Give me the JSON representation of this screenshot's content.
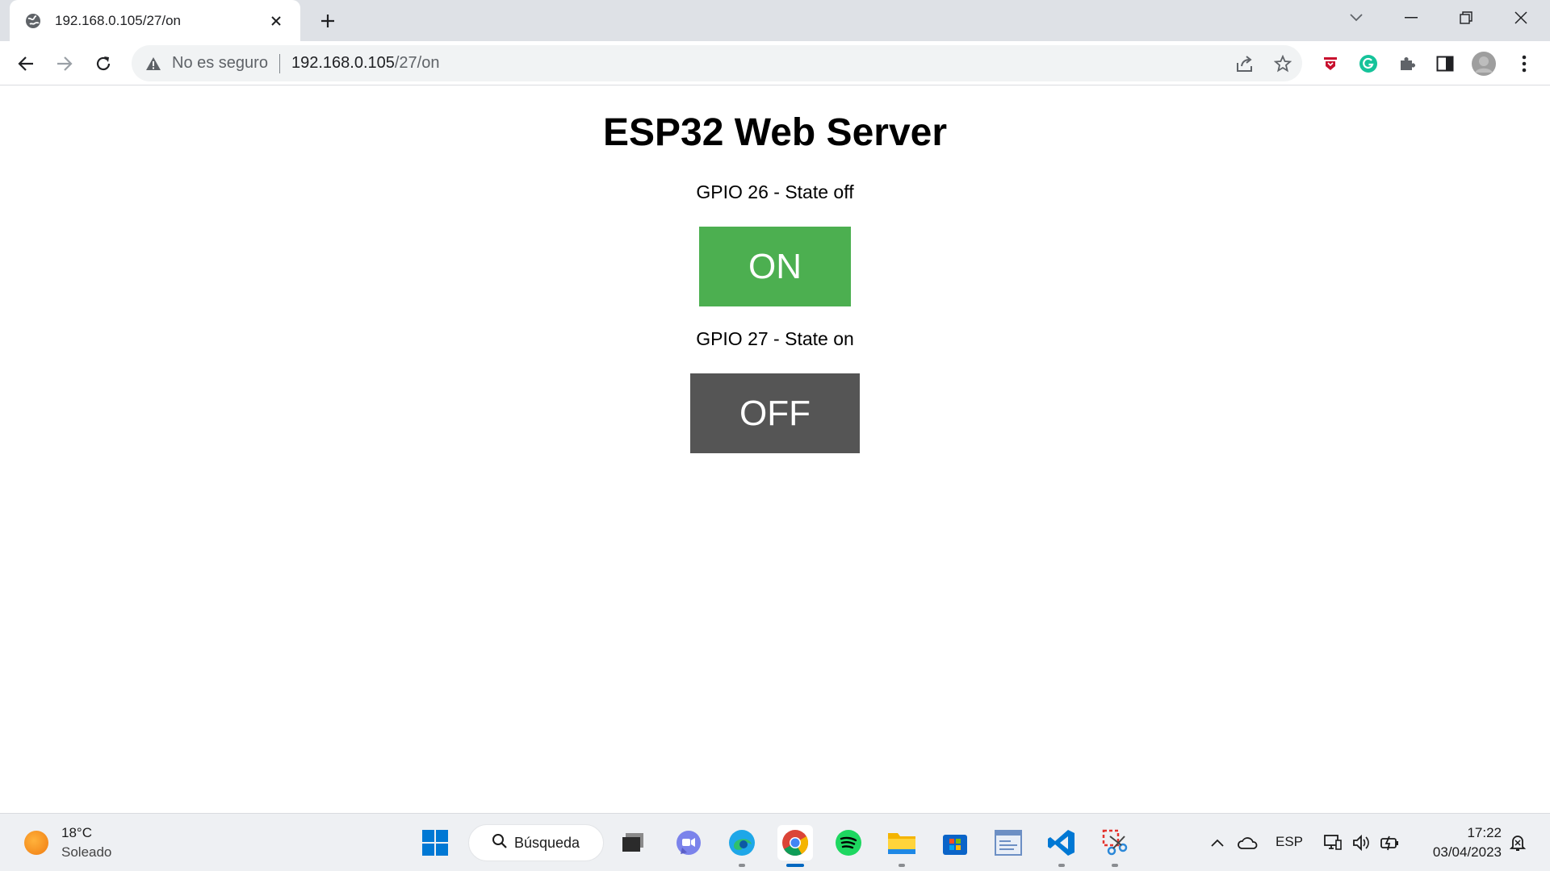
{
  "browser": {
    "tab": {
      "title": "192.168.0.105/27/on",
      "favicon": "globe-icon"
    },
    "omnibox": {
      "security_label": "No es seguro",
      "url_host": "192.168.0.105",
      "url_path": "/27/on"
    },
    "colors": {
      "tabstrip": "#dee1e6",
      "omnibox": "#f1f3f4"
    }
  },
  "page": {
    "title": "ESP32 Web Server",
    "gpio": [
      {
        "label": "GPIO 26 - State off",
        "button": "ON",
        "color": "#4caf50"
      },
      {
        "label": "GPIO 27 - State on",
        "button": "OFF",
        "color": "#555555"
      }
    ]
  },
  "taskbar": {
    "weather": {
      "temp": "18°C",
      "condition": "Soleado"
    },
    "search_label": "Búsqueda",
    "apps": [
      "start-icon",
      "task-view-icon",
      "teams-icon",
      "edge-icon",
      "chrome-icon",
      "spotify-icon",
      "file-explorer-icon",
      "store-icon",
      "app-window-icon",
      "vscode-icon",
      "snipping-tool-icon"
    ],
    "tray": {
      "language": "ESP",
      "time": "17:22",
      "date": "03/04/2023"
    }
  }
}
